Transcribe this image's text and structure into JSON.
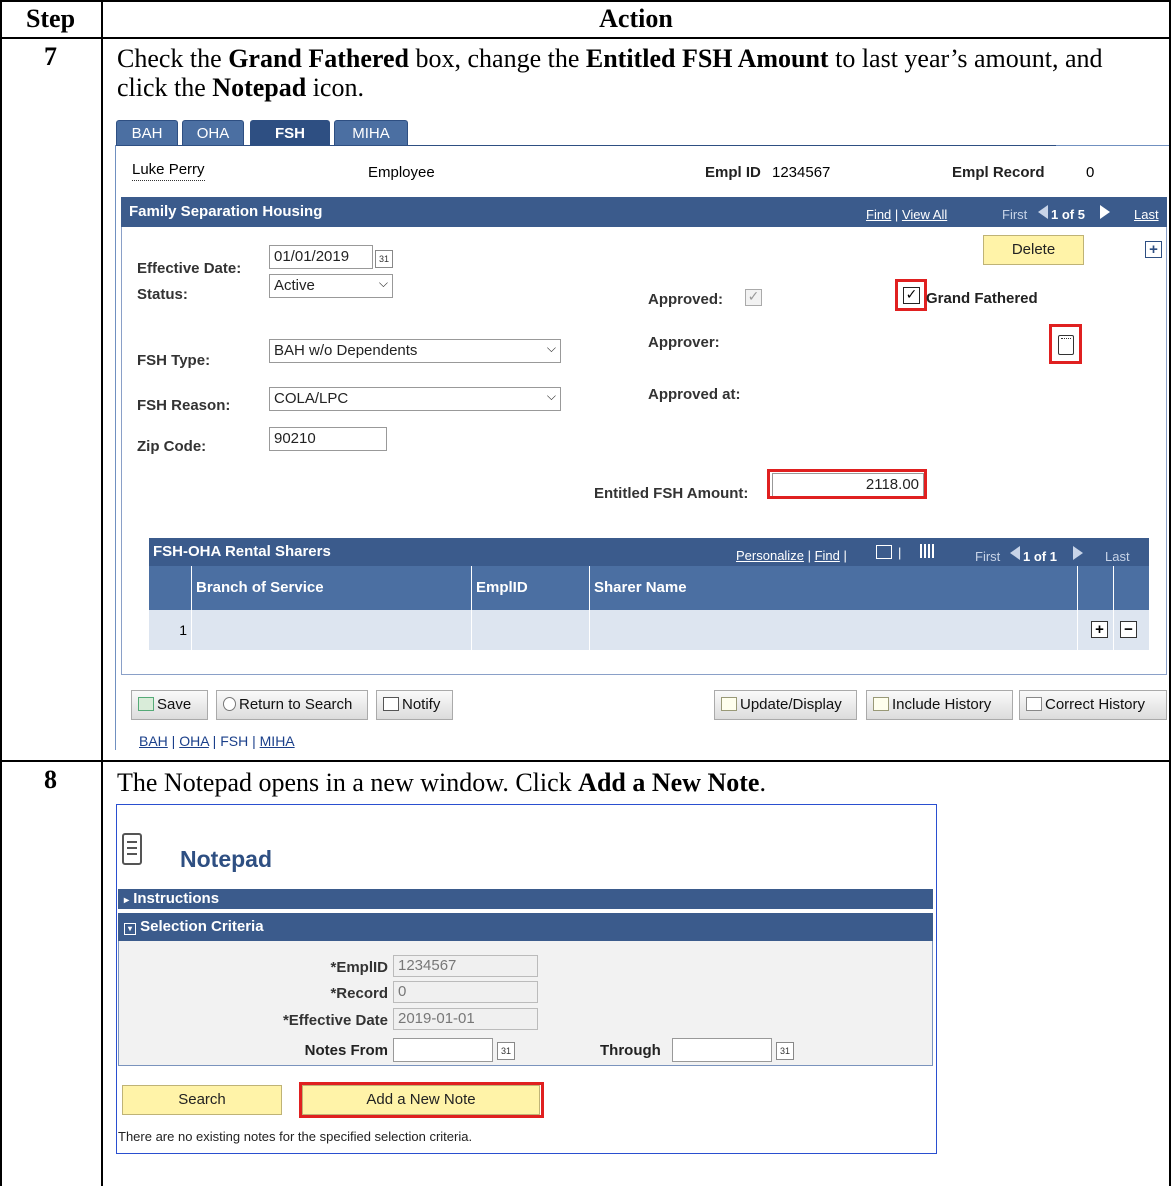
{
  "table": {
    "header_step": "Step",
    "header_action": "Action"
  },
  "step7": {
    "number": "7",
    "instr_p1": "Check the ",
    "instr_b1": "Grand Fathered",
    "instr_p2": " box, change the ",
    "instr_b2": "Entitled FSH Amount",
    "instr_p3": " to last year’s amount, and click the ",
    "instr_b3": "Notepad",
    "instr_p4": " icon.",
    "tabs": [
      "BAH",
      "OHA",
      "FSH",
      "MIHA"
    ],
    "employee_name": "Luke Perry",
    "employee_role": "Employee",
    "empl_id_label": "Empl ID",
    "empl_id_value": "1234567",
    "empl_record_label": "Empl Record",
    "empl_record_value": "0",
    "section_title": "Family Separation Housing",
    "nav_find": "Find",
    "nav_sep": "|",
    "nav_viewall": "View All",
    "nav_first": "First",
    "nav_count": "1 of 5",
    "nav_last": "Last",
    "delete_label": "Delete",
    "effective_date_label": "Effective Date:",
    "effective_date_value": "01/01/2019",
    "status_label": "Status:",
    "status_value": "Active",
    "approved_label": "Approved:",
    "grand_fathered_label": "Grand Fathered",
    "approver_label": "Approver:",
    "fsh_type_label": "FSH Type:",
    "fsh_type_value": "BAH w/o Dependents",
    "fsh_reason_label": "FSH Reason:",
    "fsh_reason_value": "COLA/LPC",
    "approved_at_label": "Approved at:",
    "zip_label": "Zip Code:",
    "zip_value": "90210",
    "entitled_label": "Entitled FSH Amount:",
    "entitled_value": "2118.00",
    "grid_title": "FSH-OHA Rental Sharers",
    "grid_personalize": "Personalize",
    "grid_find": "Find",
    "grid_first": "First",
    "grid_count": "1 of 1",
    "grid_last": "Last",
    "col_branch": "Branch of Service",
    "col_emplid": "EmplID",
    "col_sharer": "Sharer Name",
    "row_number": "1",
    "btn_save": "Save",
    "btn_return": "Return to Search",
    "btn_notify": "Notify",
    "btn_update": "Update/Display",
    "btn_include": "Include History",
    "btn_correct": "Correct History",
    "bottom_links": [
      "BAH",
      "OHA",
      "FSH",
      "MIHA"
    ]
  },
  "step8": {
    "number": "8",
    "instr_p1": "The Notepad opens in a new window. Click ",
    "instr_b1": "Add a New Note",
    "instr_p2": ".",
    "title": "Notepad",
    "instructions_label": "Instructions",
    "selection_label": "Selection Criteria",
    "emplid_label": "*EmplID",
    "emplid_value": "1234567",
    "record_label": "*Record",
    "record_value": "0",
    "effdate_label": "*Effective Date",
    "effdate_value": "2019-01-01",
    "notes_from_label": "Notes From",
    "through_label": "Through",
    "search_label": "Search",
    "add_note_label": "Add a New Note",
    "no_notes_msg": "There are no existing notes for the specified selection criteria."
  },
  "colors": {
    "bar_blue": "#3b5b8c",
    "tab_blue": "#4b6fa2",
    "highlight_red": "#e02020",
    "button_yellow": "#fff3a8"
  }
}
